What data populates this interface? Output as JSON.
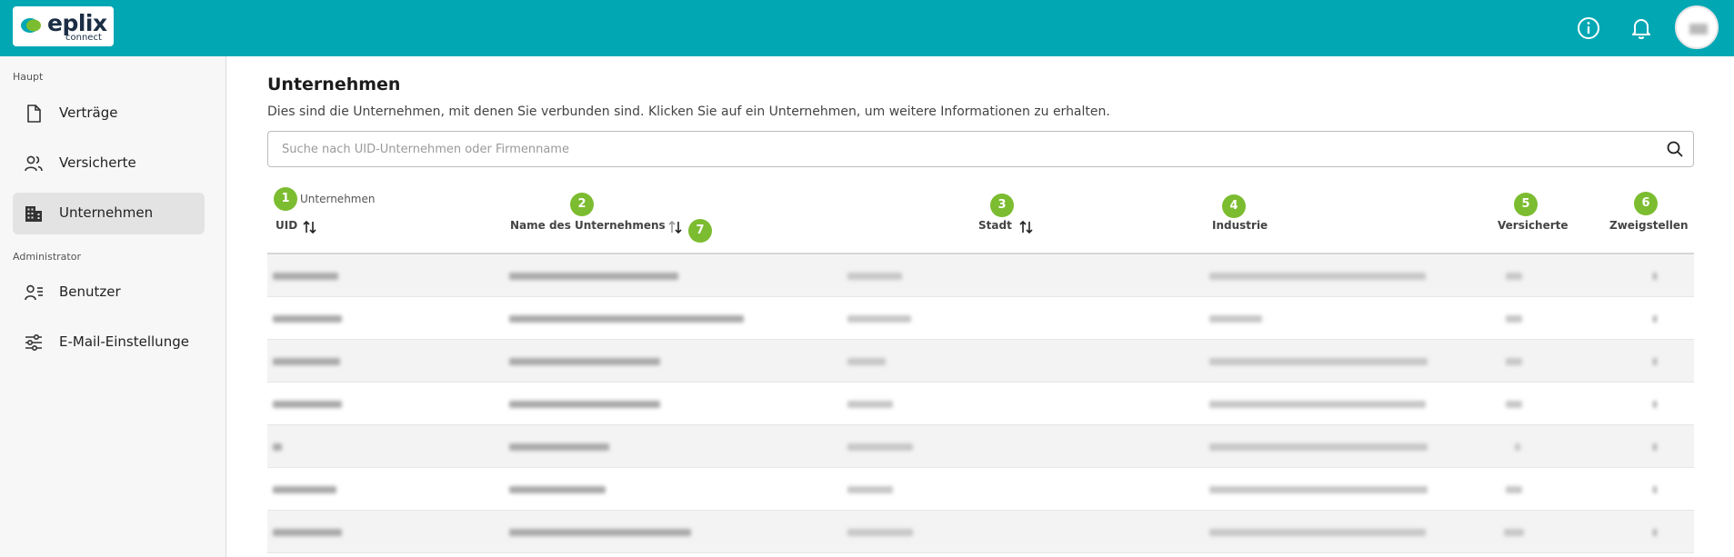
{
  "app": {
    "logo_name": "eplix",
    "logo_sub": "connect",
    "accent": "#02a7b4",
    "badge_color": "#7cbc30"
  },
  "header": {
    "icons": [
      "info-icon",
      "bell-icon"
    ]
  },
  "sidebar": {
    "section_main": "Haupt",
    "section_admin": "Administrator",
    "items": [
      {
        "label": "Verträge",
        "icon": "document-icon",
        "active": false
      },
      {
        "label": "Versicherte",
        "icon": "users-icon",
        "active": false
      },
      {
        "label": "Unternehmen",
        "icon": "building-icon",
        "active": true
      },
      {
        "label": "Benutzer",
        "icon": "user-card-icon",
        "active": false
      },
      {
        "label": "E-Mail-Einstellunge",
        "icon": "sliders-icon",
        "active": false
      }
    ]
  },
  "main": {
    "title": "Unternehmen",
    "description": "Dies sind die Unternehmen, mit denen Sie verbunden sind. Klicken Sie auf ein Unternehmen, um weitere Informationen zu erhalten.",
    "search_placeholder": "Suche nach UID-Unternehmen oder Firmenname",
    "count_label": "Unternehmen",
    "columns": [
      {
        "label": "UID",
        "sortable": true
      },
      {
        "label": "Name des Unternehmens",
        "sortable": true
      },
      {
        "label": "Stadt",
        "sortable": true
      },
      {
        "label": "Industrie",
        "sortable": false
      },
      {
        "label": "Versicherte",
        "sortable": false
      },
      {
        "label": "Zweigstellen",
        "sortable": false
      }
    ],
    "badges": [
      "1",
      "2",
      "3",
      "4",
      "5",
      "6",
      "7"
    ],
    "row_count": 7
  }
}
